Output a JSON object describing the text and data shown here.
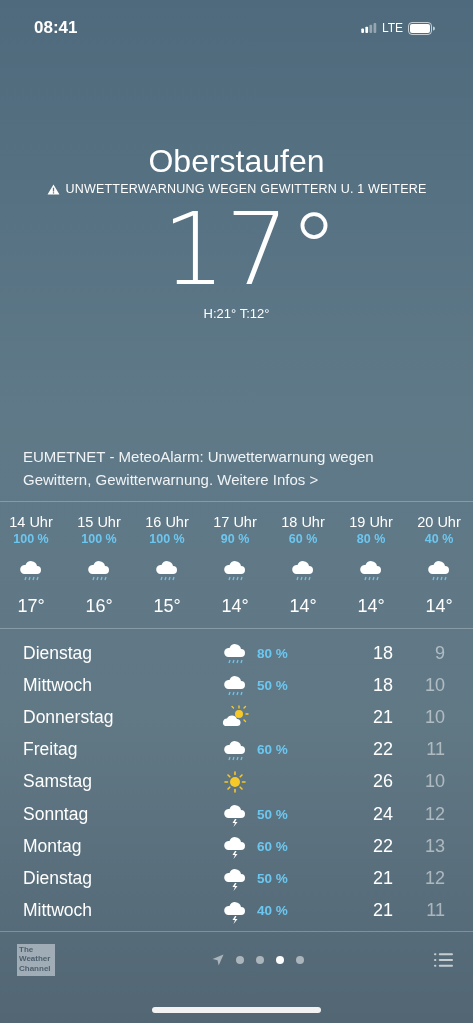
{
  "status_bar": {
    "time": "08:41",
    "network": "LTE"
  },
  "location": {
    "city": "Oberstaufen",
    "warning": "UNWETTERWARNUNG WEGEN GEWITTERN U. 1 WEITERE",
    "temperature": "17°",
    "high_low": "H:21°  T:12°"
  },
  "alert": {
    "text": "EUMETNET - MeteoAlarm: Unwetterwarnung wegen Gewittern, Gewitterwarnung.",
    "link": "Weitere Infos",
    "chevron": ">"
  },
  "hourly": [
    {
      "time": "14 Uhr",
      "precip": "100 %",
      "kind": "rain",
      "temp": "17°"
    },
    {
      "time": "15 Uhr",
      "precip": "100 %",
      "kind": "rain",
      "temp": "16°"
    },
    {
      "time": "16 Uhr",
      "precip": "100 %",
      "kind": "rain",
      "temp": "15°"
    },
    {
      "time": "17 Uhr",
      "precip": "90 %",
      "kind": "rain",
      "temp": "14°"
    },
    {
      "time": "18 Uhr",
      "precip": "60 %",
      "kind": "rain",
      "temp": "14°"
    },
    {
      "time": "19 Uhr",
      "precip": "80 %",
      "kind": "rain",
      "temp": "14°"
    },
    {
      "time": "20 Uhr",
      "precip": "40 %",
      "kind": "rain",
      "temp": "14°"
    }
  ],
  "daily": [
    {
      "day": "Dienstag",
      "kind": "rain",
      "precip": "80 %",
      "high": "18",
      "low": "9"
    },
    {
      "day": "Mittwoch",
      "kind": "rain",
      "precip": "50 %",
      "high": "18",
      "low": "10"
    },
    {
      "day": "Donnerstag",
      "kind": "partly-sunny",
      "high": "21",
      "low": "10"
    },
    {
      "day": "Freitag",
      "kind": "rain",
      "precip": "60 %",
      "high": "22",
      "low": "11"
    },
    {
      "day": "Samstag",
      "kind": "sun",
      "high": "26",
      "low": "10"
    },
    {
      "day": "Sonntag",
      "kind": "thunder",
      "precip": "50 %",
      "high": "24",
      "low": "12"
    },
    {
      "day": "Montag",
      "kind": "thunder",
      "precip": "60 %",
      "high": "22",
      "low": "13"
    },
    {
      "day": "Dienstag",
      "kind": "thunder",
      "precip": "50 %",
      "high": "21",
      "low": "12"
    },
    {
      "day": "Mittwoch",
      "kind": "thunder",
      "precip": "40 %",
      "high": "21",
      "low": "11"
    }
  ],
  "footer": {
    "logo": [
      "The",
      "Weather",
      "Channel"
    ],
    "pages": [
      {
        "kind": "location",
        "selected": false
      },
      {
        "kind": "dot",
        "selected": false
      },
      {
        "kind": "dot",
        "selected": false
      },
      {
        "kind": "dot",
        "selected": true
      },
      {
        "kind": "dot",
        "selected": false
      }
    ]
  }
}
